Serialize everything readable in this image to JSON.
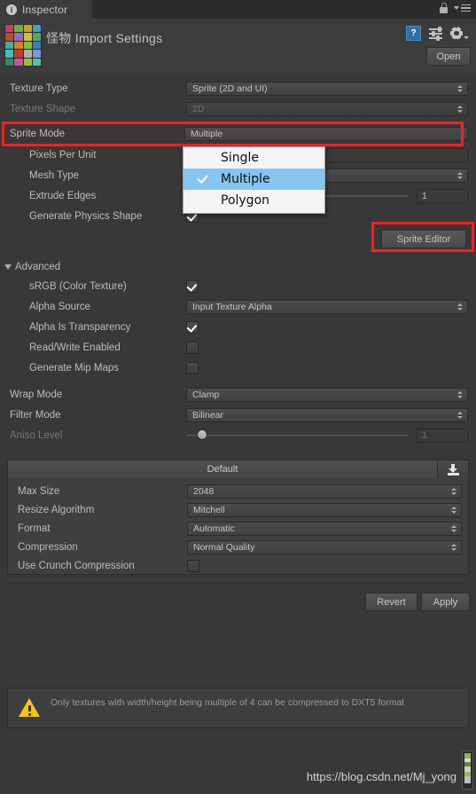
{
  "window": {
    "tab_label": "Inspector",
    "tab_icon": "info-icon",
    "lock_icon": "lock-icon",
    "menu_icon": "hamburger-menu-icon"
  },
  "header": {
    "title": "怪物 Import Settings",
    "thumbnail_icon": "sprite-sheet-thumbnail",
    "help_icon": "help-question-icon",
    "preset_icon": "preset-sliders-icon",
    "gear_icon": "gear-icon",
    "open_label": "Open",
    "sprite_colors": [
      "#c73a6d",
      "#6fae3a",
      "#c9a227",
      "#3fa0c0",
      "#b84d2a",
      "#8e6fc0",
      "#d0c23a",
      "#4fa86a",
      "#3ab0a0",
      "#d4802a",
      "#7ac03a",
      "#3a7ac0",
      "#3fbfbf",
      "#c03a3a",
      "#b0b0b0",
      "#7a9ad0",
      "#2f8f5f",
      "#c05a9a",
      "#9ac03a",
      "#5fc0a0"
    ]
  },
  "main_rows": [
    {
      "label": "Texture Type",
      "type": "dropdown",
      "value": "Sprite (2D and UI)",
      "dim": false,
      "indent": false
    },
    {
      "label": "Texture Shape",
      "type": "dropdown",
      "value": "2D",
      "dim": true,
      "indent": false
    }
  ],
  "sprite_mode": {
    "label": "Sprite Mode",
    "value": "Multiple",
    "highlighted": true
  },
  "sprite_sub_rows": [
    {
      "label": "Pixels Per Unit",
      "type": "textfield",
      "value": ""
    },
    {
      "label": "Mesh Type",
      "type": "dropdown",
      "value": ""
    },
    {
      "label": "Extrude Edges",
      "type": "slider",
      "value": "1"
    },
    {
      "label": "Generate Physics Shape",
      "type": "checkbox",
      "checked": true
    }
  ],
  "dropdown_popup": {
    "options": [
      {
        "label": "Single",
        "selected": false
      },
      {
        "label": "Multiple",
        "selected": true
      },
      {
        "label": "Polygon",
        "selected": false
      }
    ]
  },
  "sprite_editor": {
    "label": "Sprite Editor",
    "highlighted": true
  },
  "advanced": {
    "label": "Advanced",
    "expanded": true,
    "rows": [
      {
        "label": "sRGB (Color Texture)",
        "type": "checkbox",
        "checked": true
      },
      {
        "label": "Alpha Source",
        "type": "dropdown",
        "value": "Input Texture Alpha"
      },
      {
        "label": "Alpha Is Transparency",
        "type": "checkbox",
        "checked": true
      },
      {
        "label": "Read/Write Enabled",
        "type": "checkbox",
        "checked": false
      },
      {
        "label": "Generate Mip Maps",
        "type": "checkbox",
        "checked": false
      }
    ]
  },
  "texture_rows": [
    {
      "label": "Wrap Mode",
      "type": "dropdown",
      "value": "Clamp",
      "dim": false
    },
    {
      "label": "Filter Mode",
      "type": "dropdown",
      "value": "Bilinear",
      "dim": false
    },
    {
      "label": "Aniso Level",
      "type": "slider",
      "value": "1",
      "dim": true
    }
  ],
  "platform": {
    "tab_label": "Default",
    "download_icon": "download-icon",
    "rows": [
      {
        "label": "Max Size",
        "type": "dropdown",
        "value": "2048"
      },
      {
        "label": "Resize Algorithm",
        "type": "dropdown",
        "value": "Mitchell"
      },
      {
        "label": "Format",
        "type": "dropdown",
        "value": "Automatic"
      },
      {
        "label": "Compression",
        "type": "dropdown",
        "value": "Normal Quality"
      },
      {
        "label": "Use Crunch Compression",
        "type": "checkbox",
        "checked": false
      }
    ]
  },
  "actions": {
    "revert_label": "Revert",
    "apply_label": "Apply"
  },
  "warning": {
    "icon": "warning-triangle-icon",
    "text": "Only textures with width/height being multiple of 4 can be compressed to DXT5 format"
  },
  "footer": {
    "watermark": "https://blog.csdn.net/Mj_yong"
  },
  "colors": {
    "highlight": "#fc1f1f",
    "selection": "#85c5f0",
    "panel_bg": "#383838",
    "warning": "#f5c518"
  }
}
